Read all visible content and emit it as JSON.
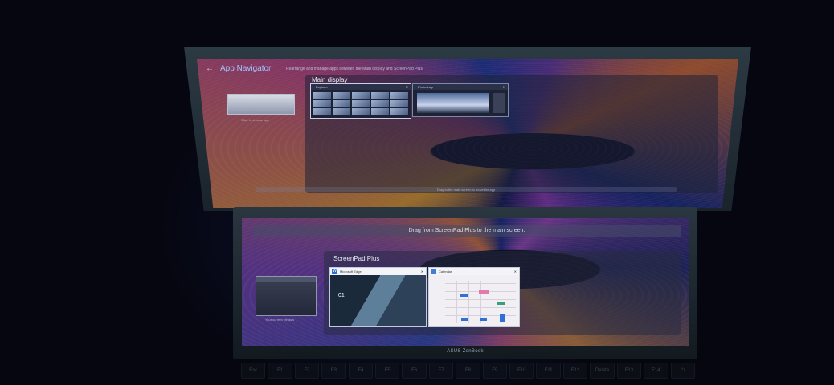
{
  "lid": {
    "back_glyph": "←",
    "title": "App Navigator",
    "subtitle": "Rearrange and manage apps between the Main display and ScreenPad Plus",
    "main_display_label": "Main display",
    "left_thumb_caption": "Click to choose app",
    "win1_title": "Explorer",
    "win2_title": "Photoshop",
    "hint": "Drag to the main screen to move the app"
  },
  "base": {
    "drag_hint": "Drag from ScreenPad Plus to the main screen.",
    "panel_title": "ScreenPad Plus",
    "mini_caption": "Your current window",
    "edge_title": "Microsoft Edge",
    "edge_icon": "W",
    "edge_number": "01",
    "calendar_title": "Calendar",
    "close_glyph": "✕",
    "brand": "ASUS ZenBook"
  },
  "keys": [
    "Esc",
    "F1",
    "F2",
    "F3",
    "F4",
    "F5",
    "F6",
    "F7",
    "F8",
    "F9",
    "F10",
    "F11",
    "F12",
    "Delete",
    "F13",
    "F14",
    "⏻"
  ],
  "colors": {
    "accent": "#9ec6ff",
    "edge_icon": "#2f6fd6"
  }
}
